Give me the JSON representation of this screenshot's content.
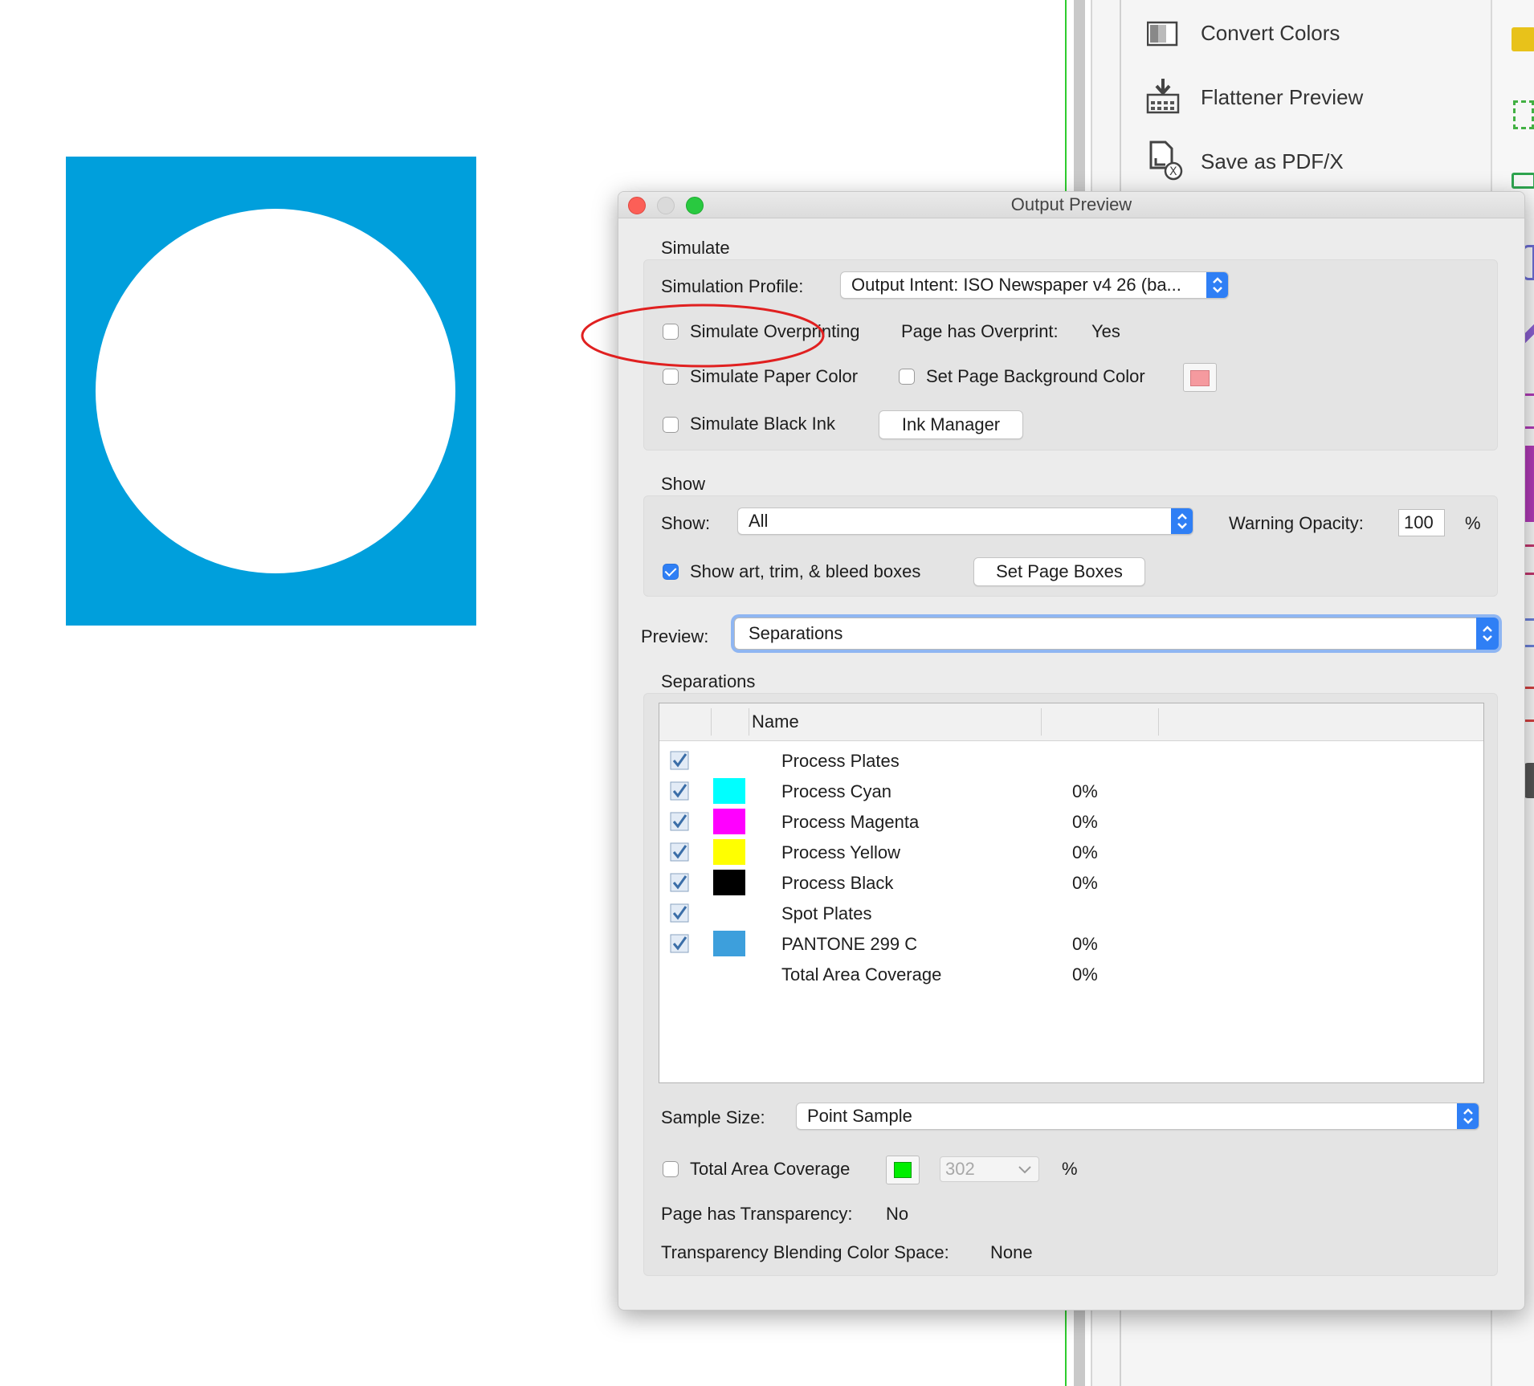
{
  "right_panel": {
    "tools": [
      {
        "label": "Convert Colors",
        "icon": "convert-colors-icon"
      },
      {
        "label": "Flattener Preview",
        "icon": "flattener-preview-icon"
      },
      {
        "label": "Save as PDF/X",
        "icon": "save-pdfx-icon"
      }
    ]
  },
  "canvas": {
    "artwork_color": "#009fdc",
    "circle_color": "#ffffff"
  },
  "dialog": {
    "title": "Output Preview",
    "simulate": {
      "section_label": "Simulate",
      "profile_label": "Simulation Profile:",
      "profile_value": "Output Intent: ISO Newspaper v4 26 (ba...",
      "simulate_overprinting": {
        "label": "Simulate Overprinting",
        "checked": false
      },
      "page_has_overprint_label": "Page has Overprint:",
      "page_has_overprint_value": "Yes",
      "simulate_paper_color": {
        "label": "Simulate Paper Color",
        "checked": false
      },
      "set_page_background": {
        "label": "Set Page Background Color",
        "checked": false,
        "swatch": "#f59a9f"
      },
      "simulate_black_ink": {
        "label": "Simulate Black Ink",
        "checked": false
      },
      "ink_manager_label": "Ink Manager"
    },
    "show": {
      "section_label": "Show",
      "show_label": "Show:",
      "show_value": "All",
      "warning_opacity_label": "Warning Opacity:",
      "warning_opacity_value": "100",
      "percent": "%",
      "show_boxes": {
        "label": "Show art, trim, & bleed boxes",
        "checked": true
      },
      "set_page_boxes_label": "Set Page Boxes"
    },
    "preview": {
      "label": "Preview:",
      "value": "Separations"
    },
    "separations": {
      "section_label": "Separations",
      "header_name": "Name",
      "rows": [
        {
          "name": "Process Plates",
          "pct": "",
          "swatch": null,
          "checkbox": true
        },
        {
          "name": "Process Cyan",
          "pct": "0%",
          "swatch": "#00ffff",
          "checkbox": true
        },
        {
          "name": "Process Magenta",
          "pct": "0%",
          "swatch": "#ff00ff",
          "checkbox": true
        },
        {
          "name": "Process Yellow",
          "pct": "0%",
          "swatch": "#ffff00",
          "checkbox": true
        },
        {
          "name": "Process Black",
          "pct": "0%",
          "swatch": "#000000",
          "checkbox": true
        },
        {
          "name": "Spot Plates",
          "pct": "",
          "swatch": null,
          "checkbox": true
        },
        {
          "name": "PANTONE 299 C",
          "pct": "0%",
          "swatch": "#3d9fdc",
          "checkbox": true
        },
        {
          "name": "Total Area Coverage",
          "pct": "0%",
          "swatch": null,
          "checkbox": false
        }
      ]
    },
    "sample_size": {
      "label": "Sample Size:",
      "value": "Point Sample"
    },
    "total_area_coverage": {
      "label": "Total Area Coverage",
      "checked": false,
      "swatch": "#00ee00",
      "value": "302",
      "percent": "%"
    },
    "transparency": {
      "label": "Page has Transparency:",
      "value": "No",
      "blend_label": "Transparency Blending Color Space:",
      "blend_value": "None"
    }
  },
  "annotation": {
    "color": "#e02020"
  }
}
